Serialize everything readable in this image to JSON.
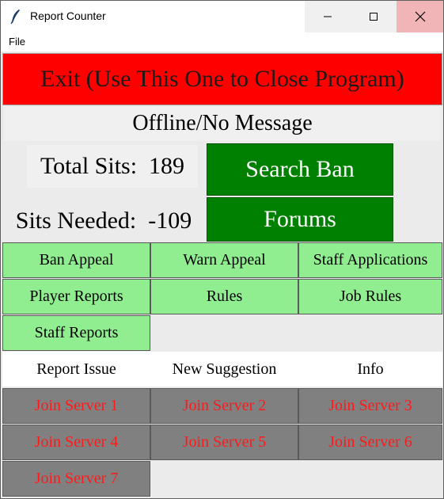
{
  "window": {
    "title": "Report Counter"
  },
  "menu": {
    "file": "File"
  },
  "exit_button": "Exit (Use This One to Close Program)",
  "status": "Offline/No Message",
  "stats": {
    "total_sits": "Total Sits:  189",
    "sits_needed": "Sits Needed:  -109"
  },
  "actions": {
    "search_ban": "Search Ban",
    "forums": "Forums"
  },
  "links": {
    "ban_appeal": "Ban Appeal",
    "warn_appeal": "Warn Appeal",
    "staff_applications": "Staff Applications",
    "player_reports": "Player Reports",
    "rules": "Rules",
    "job_rules": "Job Rules",
    "staff_reports": "Staff Reports"
  },
  "misc": {
    "report_issue": "Report Issue",
    "new_suggestion": "New Suggestion",
    "info": "Info"
  },
  "servers": [
    "Join Server 1",
    "Join Server 2",
    "Join Server 3",
    "Join Server 4",
    "Join Server 5",
    "Join Server 6",
    "Join Server 7"
  ],
  "colors": {
    "exit_bg": "#ff0000",
    "action_bg": "#008000",
    "link_bg": "#90ee90",
    "server_bg": "#808080",
    "server_text": "#ff1a1a"
  },
  "icons": {
    "app": "feather-icon",
    "minimize": "minimize-icon",
    "maximize": "maximize-icon",
    "close": "close-icon"
  }
}
